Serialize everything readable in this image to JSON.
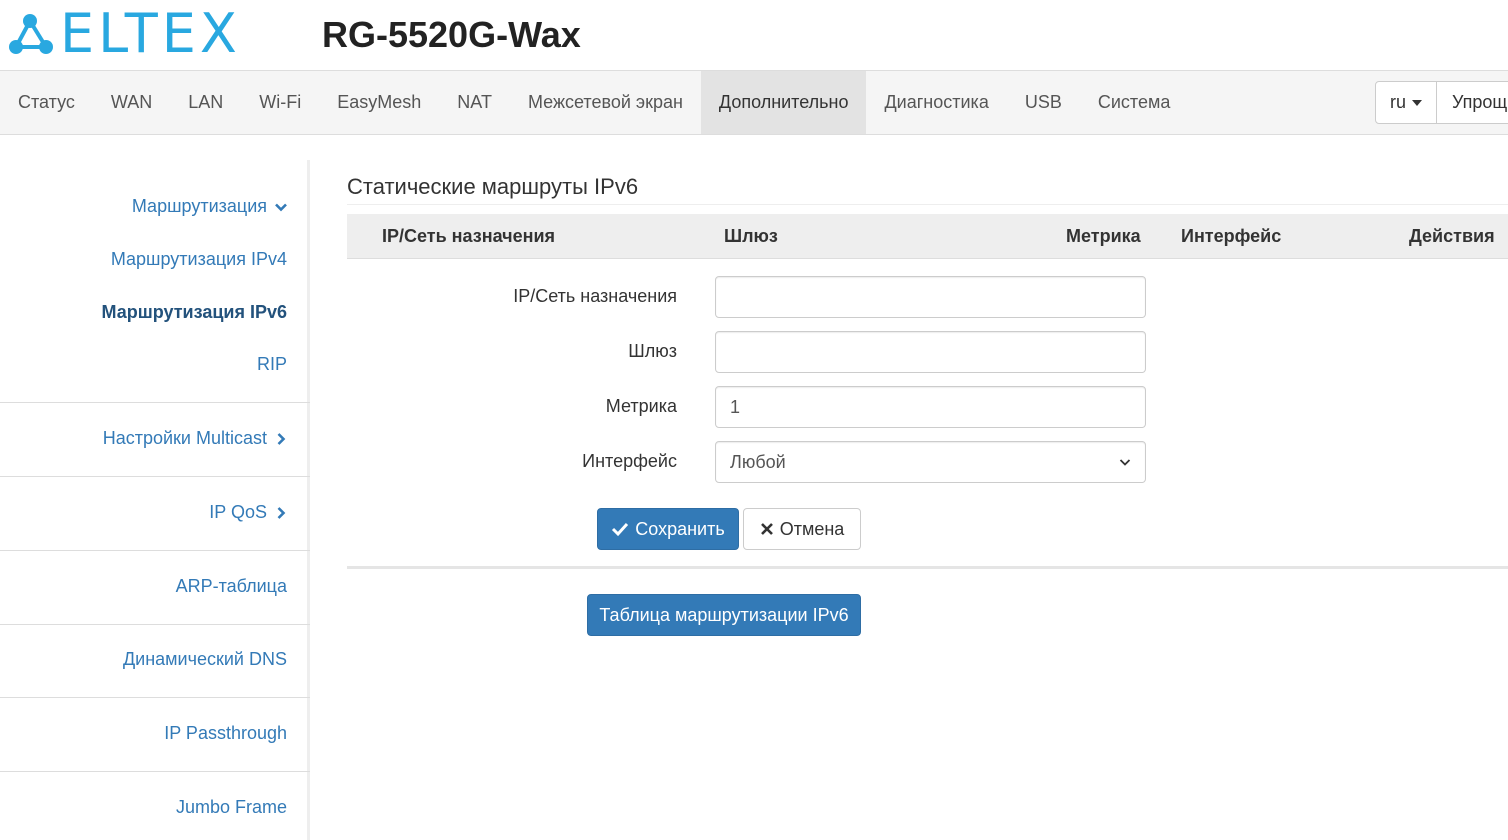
{
  "header": {
    "brand": "ELTEX",
    "device_model": "RG-5520G-Wax",
    "brand_color": "#29a8e0"
  },
  "nav": {
    "items": [
      {
        "label": "Статус"
      },
      {
        "label": "WAN"
      },
      {
        "label": "LAN"
      },
      {
        "label": "Wi-Fi"
      },
      {
        "label": "EasyMesh"
      },
      {
        "label": "NAT"
      },
      {
        "label": "Межсетевой экран"
      },
      {
        "label": "Дополнительно",
        "active": true
      },
      {
        "label": "Диагностика"
      },
      {
        "label": "USB"
      },
      {
        "label": "Система"
      }
    ],
    "language": "ru",
    "mode_button": "Упрощ"
  },
  "sidebar": {
    "items": [
      {
        "label": "Маршрутизация",
        "icon": "chevron-down-icon"
      },
      {
        "label": "Маршрутизация IPv4"
      },
      {
        "label": "Маршрутизация IPv6",
        "active": true
      },
      {
        "label": "RIP"
      },
      {
        "label": "Настройки Multicast",
        "icon": "chevron-right-icon"
      },
      {
        "label": "IP QoS",
        "icon": "chevron-right-icon"
      },
      {
        "label": "ARP-таблица"
      },
      {
        "label": "Динамический DNS"
      },
      {
        "label": "IP Passthrough"
      },
      {
        "label": "Jumbo Frame"
      }
    ]
  },
  "main": {
    "title": "Статические маршруты IPv6",
    "table": {
      "columns": [
        "IP/Сеть назначения",
        "Шлюз",
        "Метрика",
        "Интерфейс",
        "Действия"
      ]
    },
    "form": {
      "destination_label": "IP/Сеть назначения",
      "destination_value": "",
      "gateway_label": "Шлюз",
      "gateway_value": "",
      "metric_label": "Метрика",
      "metric_value": "1",
      "interface_label": "Интерфейс",
      "interface_value": "Любой"
    },
    "save_button": "Сохранить",
    "cancel_button": "Отмена",
    "routing_table_button": "Таблица маршрутизации IPv6"
  },
  "colors": {
    "primary": "#337ab7",
    "link": "#337ab7",
    "nav_active_bg": "#e3e3e3"
  }
}
